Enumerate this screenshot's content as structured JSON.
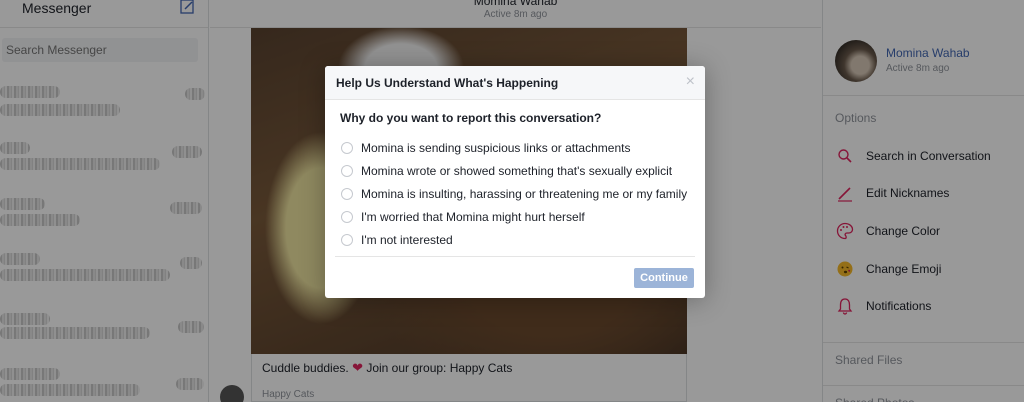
{
  "left_panel": {
    "title": "Messenger",
    "search_placeholder": "Search Messenger"
  },
  "header": {
    "name": "Momina Wahab",
    "status": "Active 8m ago"
  },
  "post": {
    "caption_prefix": "Cuddle buddies.",
    "caption_suffix": "Join our group: Happy Cats",
    "sender": "Happy Cats"
  },
  "profile": {
    "name": "Momina Wahab",
    "status": "Active 8m ago"
  },
  "options": {
    "label": "Options",
    "items": [
      {
        "label": "Search in Conversation",
        "icon": "search-icon"
      },
      {
        "label": "Edit Nicknames",
        "icon": "pencil-icon"
      },
      {
        "label": "Change Color",
        "icon": "palette-icon"
      },
      {
        "label": "Change Emoji",
        "icon": "emoji-icon"
      },
      {
        "label": "Notifications",
        "icon": "bell-icon"
      }
    ]
  },
  "sections": {
    "shared_files": "Shared Files",
    "shared_photos": "Shared Photos"
  },
  "dialog": {
    "title": "Help Us Understand What's Happening",
    "question": "Why do you want to report this conversation?",
    "options": [
      "Momina is sending suspicious links or attachments",
      "Momina wrote or showed something that's sexually explicit",
      "Momina is insulting, harassing or threatening me or my family",
      "I'm worried that Momina might hurt herself",
      "I'm not interested"
    ],
    "continue_label": "Continue"
  },
  "colors": {
    "accent": "#4267b2",
    "continue_disabled": "#9cb4d8",
    "icon_red": "#e0245e"
  }
}
